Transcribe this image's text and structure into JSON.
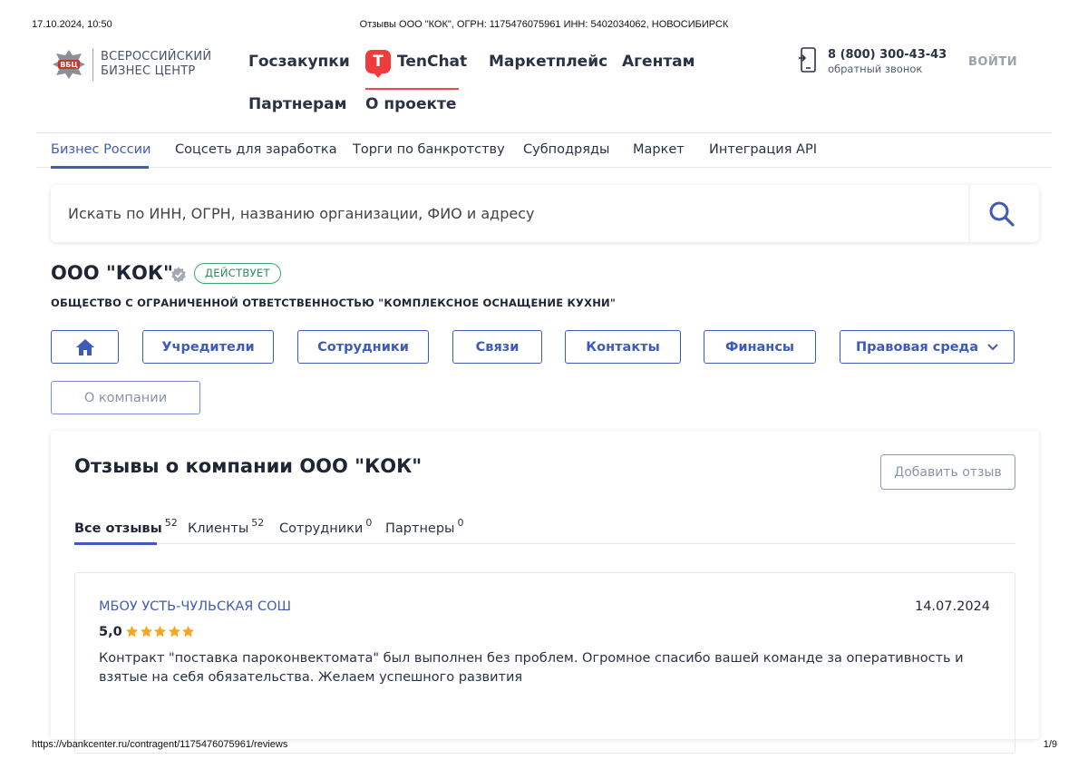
{
  "print": {
    "datetime": "17.10.2024, 10:50",
    "doc_title": "Отзывы ООО \"КОК\", ОГРН: 1175476075961 ИНН: 5402034062, НОВОСИБИРСК",
    "url": "https://vbankcenter.ru/contragent/1175476075961/reviews",
    "page": "1/9"
  },
  "header": {
    "logo_line1": "ВСЕРОССИЙСКИЙ",
    "logo_line2": "БИЗНЕС ЦЕНТР",
    "nav": {
      "goszakupki": "Госзакупки",
      "tenchat": "TenChat",
      "tenchat_badge": "T",
      "marketplace": "Маркетплейс",
      "agents": "Агентам",
      "partners": "Партнерам",
      "about": "О проекте"
    },
    "phone": "8 (800) 300-43-43",
    "phone_sub": "обратный звонок",
    "login": "ВОЙТИ"
  },
  "subnav": {
    "items": [
      {
        "label": "Бизнес России"
      },
      {
        "label": "Соцсеть для заработка"
      },
      {
        "label": "Торги по банкротству"
      },
      {
        "label": "Субподряды"
      },
      {
        "label": "Маркет"
      },
      {
        "label": "Интеграция API"
      }
    ]
  },
  "search": {
    "placeholder": "Искать по ИНН, ОГРН, названию организации, ФИО и адресу"
  },
  "company": {
    "name": "ООО \"КОК\"",
    "status": "ДЕЙСТВУЕТ",
    "full_name": "ОБЩЕСТВО С ОГРАНИЧЕННОЙ ОТВЕТСТВЕННОСТЬЮ \"КОМПЛЕКСНОЕ ОСНАЩЕНИЕ КУХНИ\"",
    "tabs": {
      "founders": "Учредители",
      "employees": "Сотрудники",
      "links": "Связи",
      "contacts": "Контакты",
      "finance": "Финансы",
      "legal": "Правовая среда",
      "about": "О компании"
    }
  },
  "reviews": {
    "title": "Отзывы о компании ООО \"КОК\"",
    "add_button": "Добавить отзыв",
    "tabs": [
      {
        "label": "Все отзывы",
        "count": "52"
      },
      {
        "label": "Клиенты",
        "count": "52"
      },
      {
        "label": "Сотрудники",
        "count": "0"
      },
      {
        "label": "Партнеры",
        "count": "0"
      }
    ],
    "items": [
      {
        "author": "МБОУ УСТЬ-ЧУЛЬСКАЯ СОШ",
        "date": "14.07.2024",
        "rating": "5,0",
        "stars": 5,
        "text": "Контракт \"поставка пароконвектомата\" был выполнен без проблем. Огромное спасибо вашей команде за оперативность и взятые на себя обязательства. Желаем успешного развития"
      }
    ]
  },
  "colors": {
    "accent": "#3e5bb8",
    "status_green": "#2e8b57",
    "tenchat_red": "#ee3b3b",
    "star": "#f5a623"
  }
}
